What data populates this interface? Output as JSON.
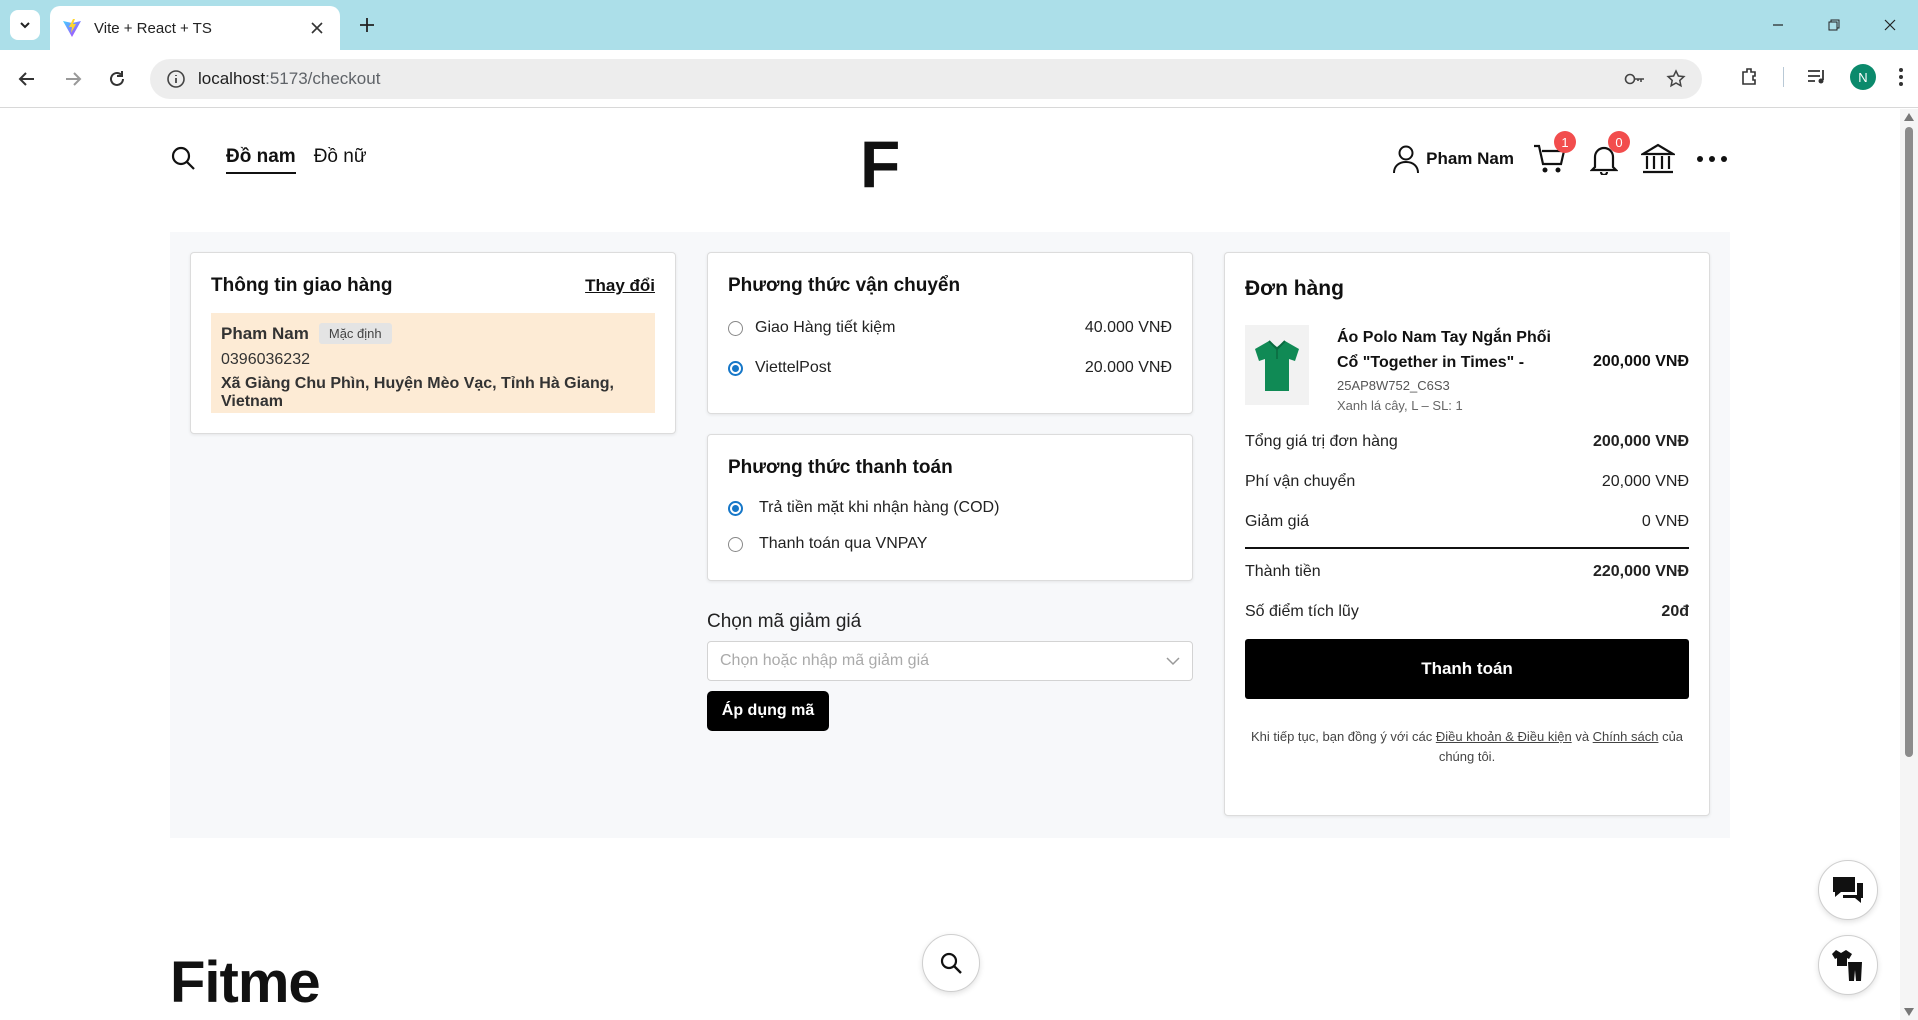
{
  "browser": {
    "tab_title": "Vite + React + TS",
    "url_host": "localhost",
    "url_rest": ":5173/checkout",
    "profile_initial": "N"
  },
  "header": {
    "nav": [
      "Đồ nam",
      "Đồ nữ"
    ],
    "logo": "F",
    "user_name": "Pham Nam",
    "cart_count": "1",
    "notif_count": "0"
  },
  "shipping_info": {
    "title": "Thông tin giao hàng",
    "change_label": "Thay đổi",
    "name": "Pham Nam",
    "default_tag": "Mặc định",
    "phone": "0396036232",
    "address": "Xã Giàng Chu Phìn, Huyện Mèo Vạc, Tỉnh Hà Giang, Vietnam"
  },
  "shipping_method": {
    "title": "Phương thức vận chuyển",
    "options": [
      {
        "label": "Giao Hàng tiết kiệm",
        "price": "40.000 VNĐ",
        "selected": false
      },
      {
        "label": "ViettelPost",
        "price": "20.000 VNĐ",
        "selected": true
      }
    ]
  },
  "payment_method": {
    "title": "Phương thức thanh toán",
    "options": [
      {
        "label": "Trả tiền mặt khi nhận hàng (COD)",
        "selected": true
      },
      {
        "label": "Thanh toán qua VNPAY",
        "selected": false
      }
    ]
  },
  "coupon": {
    "label": "Chọn mã giảm giá",
    "placeholder": "Chọn hoặc nhập mã giảm giá",
    "apply_label": "Áp dụng mã"
  },
  "order": {
    "title": "Đơn hàng",
    "product": {
      "name": "Áo Polo Nam Tay Ngắn Phối Cổ \"Together in Times\" -",
      "sku": "25AP8W752_C6S3",
      "variant": "Xanh lá cây, L – SL: 1",
      "price": "200,000 VNĐ"
    },
    "subtotal_label": "Tổng giá trị đơn hàng",
    "subtotal": "200,000 VNĐ",
    "shipping_label": "Phí vận chuyển",
    "shipping": "20,000 VNĐ",
    "discount_label": "Giảm giá",
    "discount": "0 VNĐ",
    "total_label": "Thành tiền",
    "total": "220,000 VNĐ",
    "points_label": "Số điểm tích lũy",
    "points": "20đ",
    "pay_label": "Thanh toán",
    "terms_pre": "Khi tiếp tục, bạn đồng ý với các",
    "terms_link1": "Điều khoản & Điều kiện",
    "terms_mid": "và",
    "terms_link2": "Chính sách",
    "terms_post": "của chúng tôi."
  },
  "footer": {
    "logo": "Fitme"
  },
  "colors": {
    "accent": "#1677c8",
    "address_bg": "#fdebd5",
    "badge": "#f24d4d",
    "tabbar": "#acdfe9"
  }
}
